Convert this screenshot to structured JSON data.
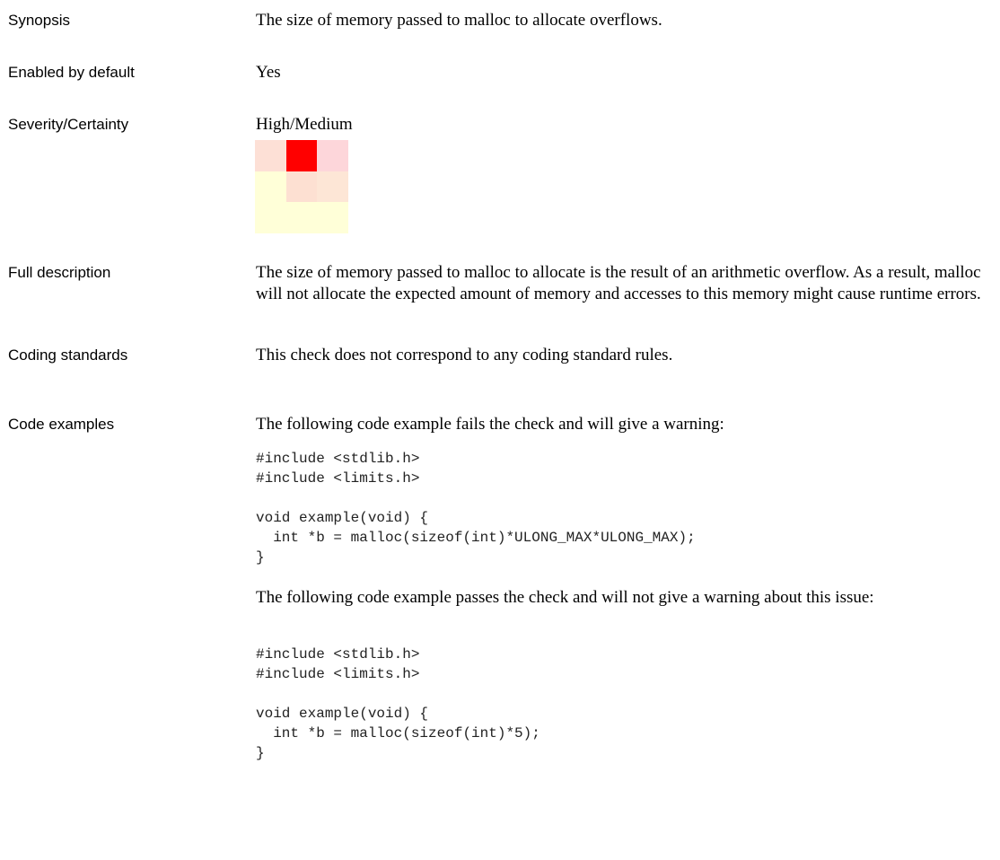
{
  "rows": {
    "synopsis": {
      "label": "Synopsis",
      "text": "The size of memory passed to malloc to allocate overflows."
    },
    "enabled": {
      "label": "Enabled by default",
      "text": "Yes"
    },
    "severity": {
      "label": "Severity/Certainty",
      "text": "High/Medium"
    },
    "full_description": {
      "label": "Full description",
      "text": "The size of memory passed to malloc to allocate is the result of an arithmetic overflow. As a result, malloc will not allocate the expected amount of memory and accesses to this memory might cause runtime errors."
    },
    "coding_standards": {
      "label": "Coding standards",
      "text": "This check does not correspond to any coding standard rules."
    },
    "code_examples": {
      "label": "Code examples",
      "fail_intro": "The following code example fails the check and will give a warning:",
      "fail_code": "#include <stdlib.h>\n#include <limits.h>\n\nvoid example(void) {\n  int *b = malloc(sizeof(int)*ULONG_MAX*ULONG_MAX);\n}",
      "pass_intro": "The following code example passes the check and will not give a warning about this issue:",
      "pass_code": "#include <stdlib.h>\n#include <limits.h>\n\nvoid example(void) {\n  int *b = malloc(sizeof(int)*5);\n}"
    }
  },
  "severity_matrix": {
    "cells": [
      [
        "#fde0d6",
        "#ff0000",
        "#fdd6da"
      ],
      [
        "#ffffd8",
        "#fde0d2",
        "#fde6d6"
      ],
      [
        "#ffffd8",
        "#ffffd8",
        "#ffffd8"
      ]
    ]
  }
}
